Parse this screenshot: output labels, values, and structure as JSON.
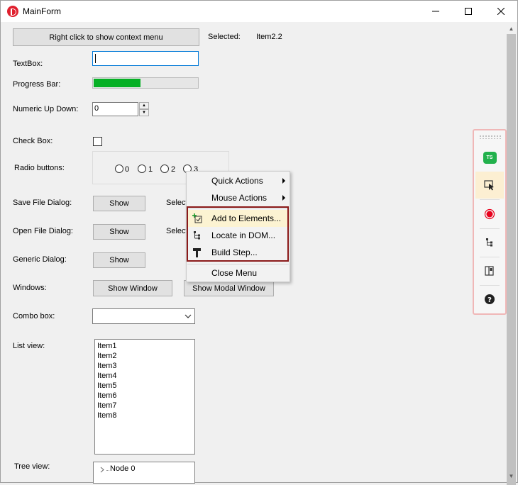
{
  "window": {
    "title": "MainForm"
  },
  "controls": {
    "context_button": "Right click to show context menu",
    "selected_label": "Selected:",
    "selected_value": "Item2.2",
    "textbox_label": "TextBox:",
    "textbox_value": "",
    "progress_label": "Progress Bar:",
    "progress_value": 0.45,
    "numeric_label": "Numeric Up Down:",
    "numeric_value": "0",
    "checkbox_label": "Check Box:",
    "radio_label": "Radio buttons:",
    "radio_options": [
      "0",
      "1",
      "2",
      "3"
    ],
    "save_dialog_label": "Save File Dialog:",
    "save_dialog_button": "Show",
    "save_dialog_select": "Select",
    "open_dialog_label": "Open File Dialog:",
    "open_dialog_button": "Show",
    "open_dialog_select": "Select",
    "generic_dialog_label": "Generic Dialog:",
    "generic_dialog_button": "Show",
    "windows_label": "Windows:",
    "show_window_button": "Show Window",
    "show_modal_button": "Show Modal Window",
    "combo_label": "Combo box:",
    "combo_value": "",
    "listview_label": "List view:",
    "list_items": [
      "Item1",
      "Item2",
      "Item3",
      "Item4",
      "Item5",
      "Item6",
      "Item7",
      "Item8"
    ],
    "treeview_label": "Tree view:",
    "tree_items": [
      "Node 0"
    ]
  },
  "context_menu": {
    "quick_actions": "Quick Actions",
    "mouse_actions": "Mouse Actions",
    "add_to_elements": "Add to Elements...",
    "locate_in_dom": "Locate in DOM...",
    "build_step": "Build Step...",
    "close_menu": "Close Menu"
  },
  "toolbar": {
    "badge": "TS",
    "icons": [
      "ts-badge-icon",
      "select-element-icon",
      "record-icon",
      "dom-tree-icon",
      "panel-icon",
      "help-icon"
    ]
  },
  "colors": {
    "progress_fill": "#06b025",
    "menu_highlight": "#fcf3d2",
    "highlight_border": "#8b1a1a",
    "record": "#e8001c",
    "badge": "#22b14c"
  }
}
